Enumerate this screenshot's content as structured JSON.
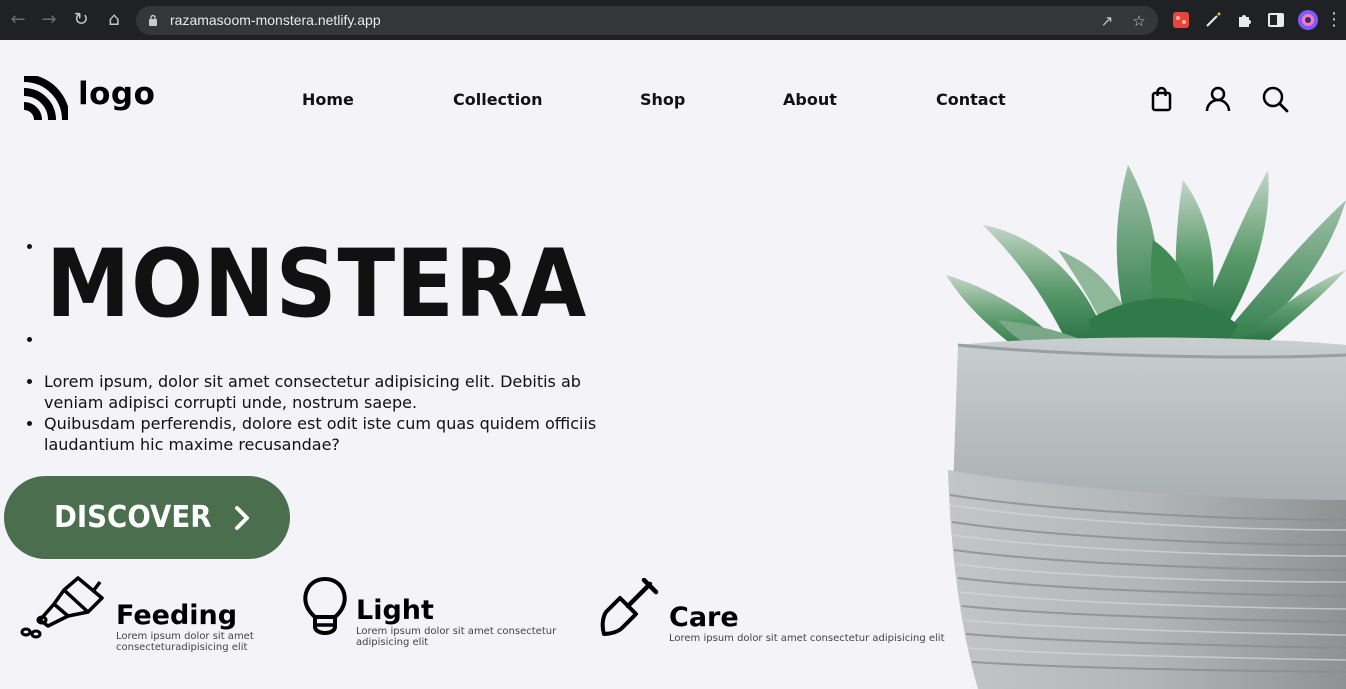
{
  "browser": {
    "url": "razamasoom-monstera.netlify.app",
    "icons": [
      "back-arrow-icon",
      "forward-arrow-icon",
      "reload-icon",
      "home-icon",
      "lock-icon",
      "share-icon",
      "star-icon",
      "extension-icon",
      "puzzle-icon",
      "sidebar-icon",
      "profile-avatar",
      "menu-dots-icon"
    ]
  },
  "site": {
    "logo_text": "logo",
    "nav": [
      "Home",
      "Collection",
      "Shop",
      "About",
      "Contact"
    ],
    "header_icons": [
      "shopping-bag-icon",
      "user-icon",
      "search-icon"
    ]
  },
  "hero": {
    "title": "MONSTERA",
    "paragraphs": [
      "Lorem ipsum, dolor sit amet consectetur adipisicing elit. Debitis ab veniam adipisci corrupti unde, nostrum saepe.",
      "Quibusdam perferendis, dolore est odit iste cum quas quidem officiis laudantium hic maxime recusandae?"
    ],
    "cta_label": "DISCOVER"
  },
  "features": [
    {
      "title": "Feeding",
      "description": "Lorem ipsum dolor sit amet consecteturadipisicing elit",
      "icon": "watering-can-icon"
    },
    {
      "title": "Light",
      "description": "Lorem ipsum dolor sit amet consectetur adipisicing elit",
      "icon": "light-bulb-icon"
    },
    {
      "title": "Care",
      "description": "Lorem ipsum dolor sit amet consectetur adipisicing elit",
      "icon": "shovel-icon"
    }
  ],
  "colors": {
    "background": "#f3f3f8",
    "accent_green": "#4a6e4e",
    "browser_chrome": "#202124"
  }
}
